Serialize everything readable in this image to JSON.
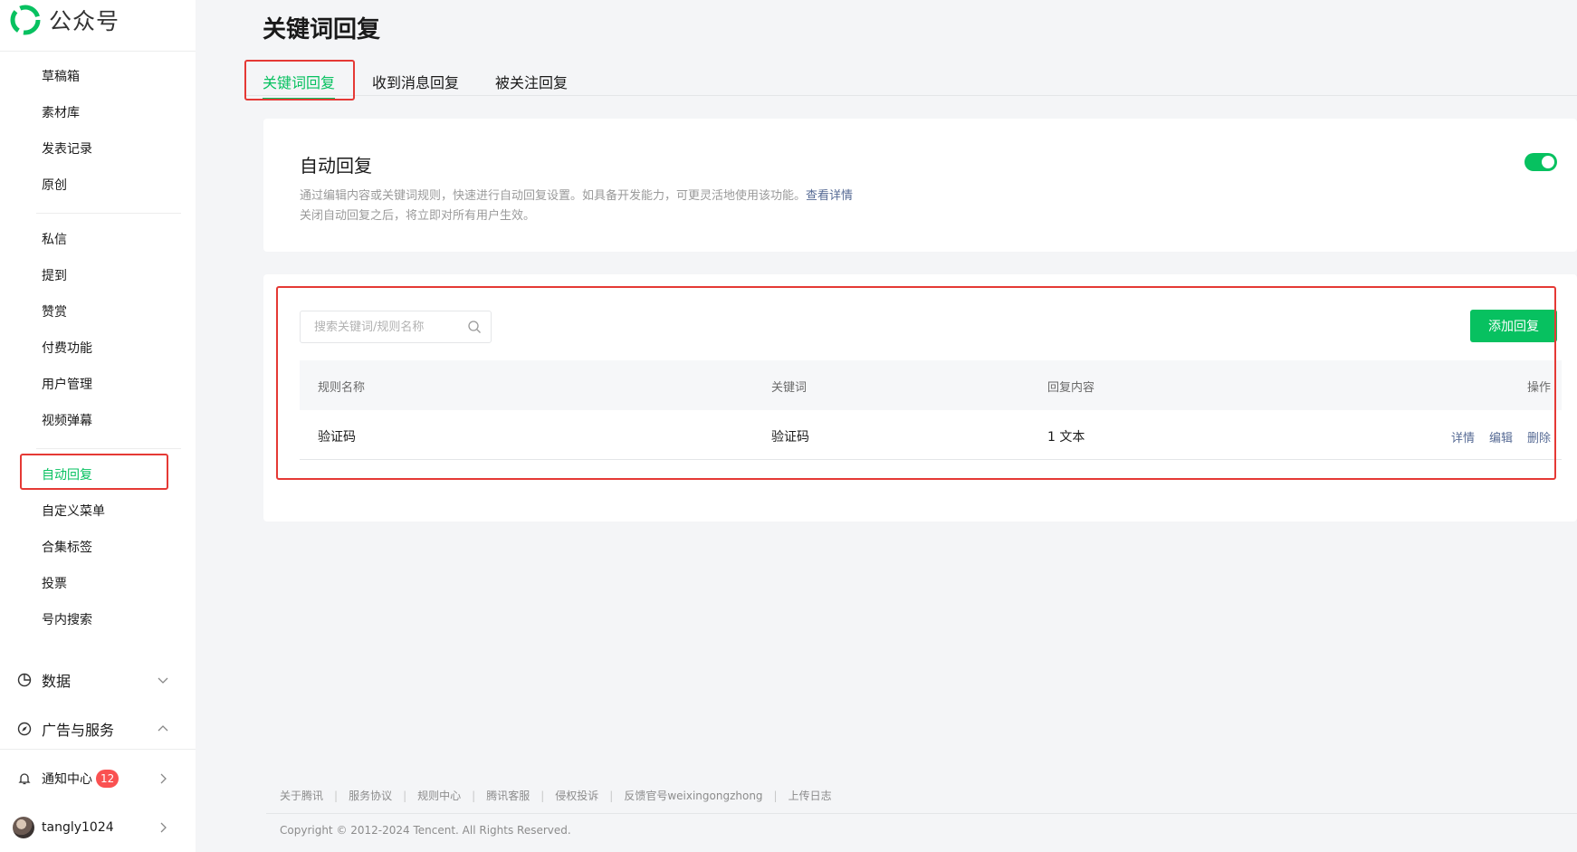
{
  "app": {
    "name": "公众号"
  },
  "sidebar": {
    "items": [
      {
        "label": "草稿箱"
      },
      {
        "label": "素材库"
      },
      {
        "label": "发表记录"
      },
      {
        "label": "原创"
      },
      {
        "label": "私信"
      },
      {
        "label": "提到"
      },
      {
        "label": "赞赏"
      },
      {
        "label": "付费功能"
      },
      {
        "label": "用户管理"
      },
      {
        "label": "视频弹幕"
      },
      {
        "label": "自动回复",
        "active": true
      },
      {
        "label": "自定义菜单"
      },
      {
        "label": "合集标签"
      },
      {
        "label": "投票"
      },
      {
        "label": "号内搜索"
      }
    ],
    "groups": {
      "data": {
        "label": "数据",
        "icon": "pie-chart-icon"
      },
      "ads": {
        "label": "广告与服务",
        "icon": "compass-icon"
      }
    },
    "notify": {
      "label": "通知中心",
      "count": "12",
      "icon": "bell-icon"
    },
    "user": {
      "name": "tangly1024"
    }
  },
  "page": {
    "title": "关键词回复"
  },
  "tabs": [
    {
      "label": "关键词回复",
      "active": true
    },
    {
      "label": "收到消息回复"
    },
    {
      "label": "被关注回复"
    }
  ],
  "auto_reply": {
    "title": "自动回复",
    "desc_line1": "通过编辑内容或关键词规则，快速进行自动回复设置。如具备开发能力，可更灵活地使用该功能。",
    "desc_link": "查看详情",
    "desc_line2": "关闭自动回复之后，将立即对所有用户生效。",
    "enabled": true
  },
  "rules": {
    "search_placeholder": "搜索关键词/规则名称",
    "add_label": "添加回复",
    "columns": {
      "name": "规则名称",
      "keyword": "关键词",
      "content": "回复内容",
      "ops": "操作"
    },
    "rows": [
      {
        "name": "验证码",
        "keyword": "验证码",
        "content": "1 文本",
        "op_detail": "详情",
        "op_edit": "编辑",
        "op_delete": "删除"
      }
    ]
  },
  "footer": {
    "links": [
      "关于腾讯",
      "服务协议",
      "规则中心",
      "腾讯客服",
      "侵权投诉",
      "反馈官号weixingongzhong",
      "上传日志"
    ],
    "copyright": "Copyright © 2012-2024 Tencent. All Rights Reserved."
  },
  "colors": {
    "brand": "#07c160",
    "link": "#576b95",
    "highlight": "#e53935",
    "badge": "#fa5151"
  }
}
